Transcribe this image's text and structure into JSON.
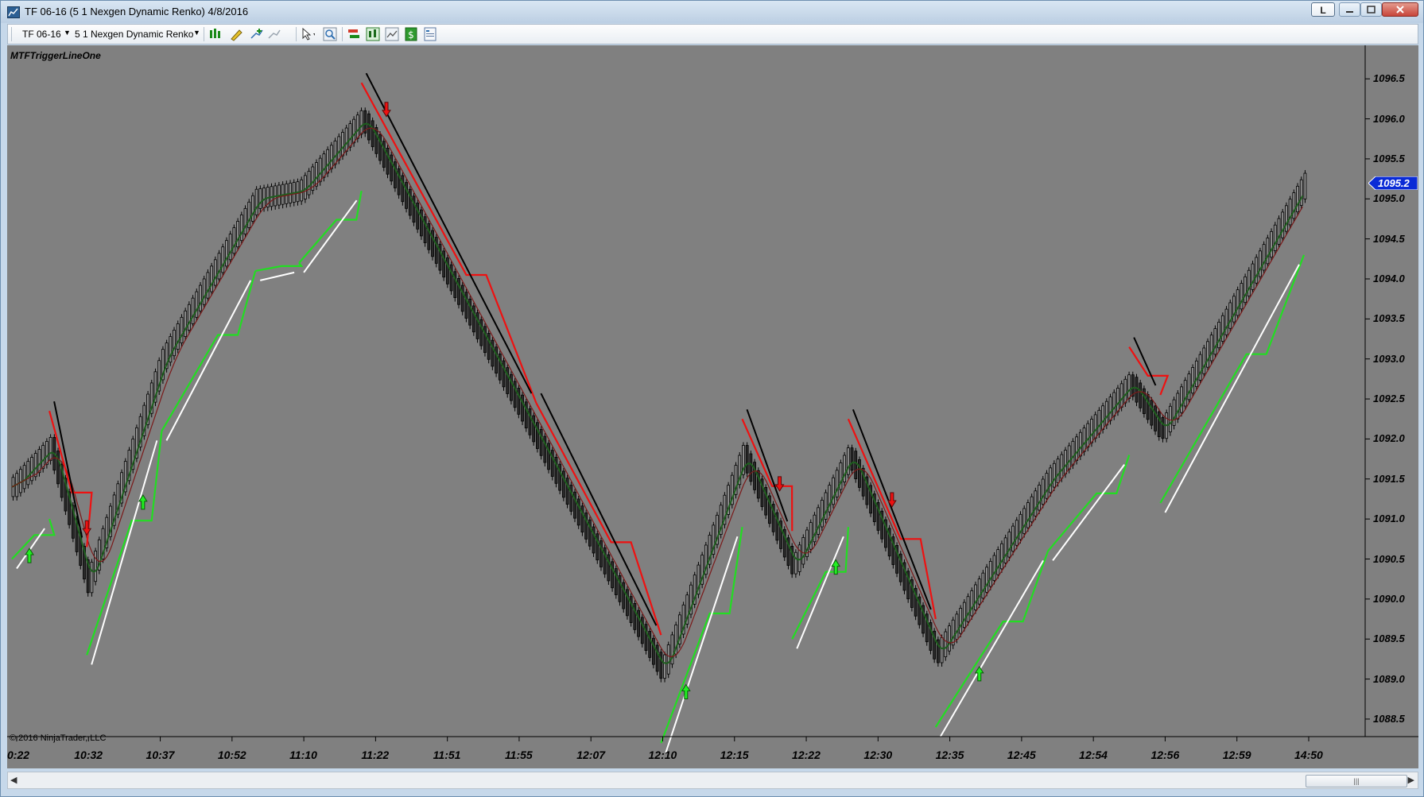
{
  "window": {
    "title": "TF 06-16 (5 1 Nexgen Dynamic Renko)  4/8/2016",
    "link_label": "L"
  },
  "toolbar": {
    "instrument": "TF 06-16",
    "bar_type": "5 1 Nexgen Dynamic Renko",
    "icons": [
      "chart-style-icon",
      "drawing-tool-icon",
      "add-indicator-icon",
      "remove-indicator-icon",
      "cursor-icon",
      "zoom-icon",
      "strategy-icon",
      "data-box-icon",
      "chart-trader-icon",
      "dollar-icon",
      "properties-icon"
    ]
  },
  "chart": {
    "indicator_name": "MTFTriggerLineOne",
    "copyright": "© 2016 NinjaTrader, LLC",
    "current_price": "1095.2",
    "colors": {
      "background": "#808080",
      "up_trigger": "#22dd22",
      "down_trigger": "#ee1111",
      "trend_line": "#000000",
      "price_tag": "#0a2bd6"
    },
    "y_axis_ticks": [
      "1096.5",
      "1096.0",
      "1095.5",
      "1095.0",
      "1094.5",
      "1094.0",
      "1093.5",
      "1093.0",
      "1092.5",
      "1092.0",
      "1091.5",
      "1091.0",
      "1090.5",
      "1090.0",
      "1089.5",
      "1089.0",
      "1088.5"
    ],
    "x_axis_ticks": [
      "0:22",
      "10:32",
      "10:37",
      "10:52",
      "11:10",
      "11:22",
      "11:51",
      "11:55",
      "12:07",
      "12:10",
      "12:15",
      "12:22",
      "12:30",
      "12:35",
      "12:45",
      "12:54",
      "12:56",
      "12:59",
      "14:50"
    ]
  },
  "chart_data": {
    "type": "candlestick",
    "title": "MTFTriggerLineOne",
    "ylim": [
      1088.4,
      1096.8
    ],
    "price_swings": [
      {
        "x": 0,
        "y": 1091.4
      },
      {
        "x": 30,
        "y": 1091.9
      },
      {
        "x": 60,
        "y": 1090.2
      },
      {
        "x": 120,
        "y": 1093.0
      },
      {
        "x": 195,
        "y": 1095.0
      },
      {
        "x": 230,
        "y": 1095.1
      },
      {
        "x": 280,
        "y": 1096.0
      },
      {
        "x": 420,
        "y": 1092.0
      },
      {
        "x": 520,
        "y": 1089.1
      },
      {
        "x": 585,
        "y": 1091.8
      },
      {
        "x": 625,
        "y": 1090.4
      },
      {
        "x": 670,
        "y": 1091.8
      },
      {
        "x": 740,
        "y": 1089.3
      },
      {
        "x": 830,
        "y": 1091.5
      },
      {
        "x": 895,
        "y": 1092.7
      },
      {
        "x": 920,
        "y": 1092.1
      },
      {
        "x": 1035,
        "y": 1095.2
      }
    ],
    "signals": [
      {
        "type": "buy",
        "x": 14
      },
      {
        "type": "sell",
        "x": 60
      },
      {
        "type": "buy",
        "x": 105
      },
      {
        "type": "sell",
        "x": 300
      },
      {
        "type": "buy",
        "x": 540
      },
      {
        "type": "sell",
        "x": 615
      },
      {
        "type": "buy",
        "x": 660
      },
      {
        "type": "sell",
        "x": 705
      },
      {
        "type": "buy",
        "x": 775
      }
    ],
    "current_price": 1095.2
  }
}
